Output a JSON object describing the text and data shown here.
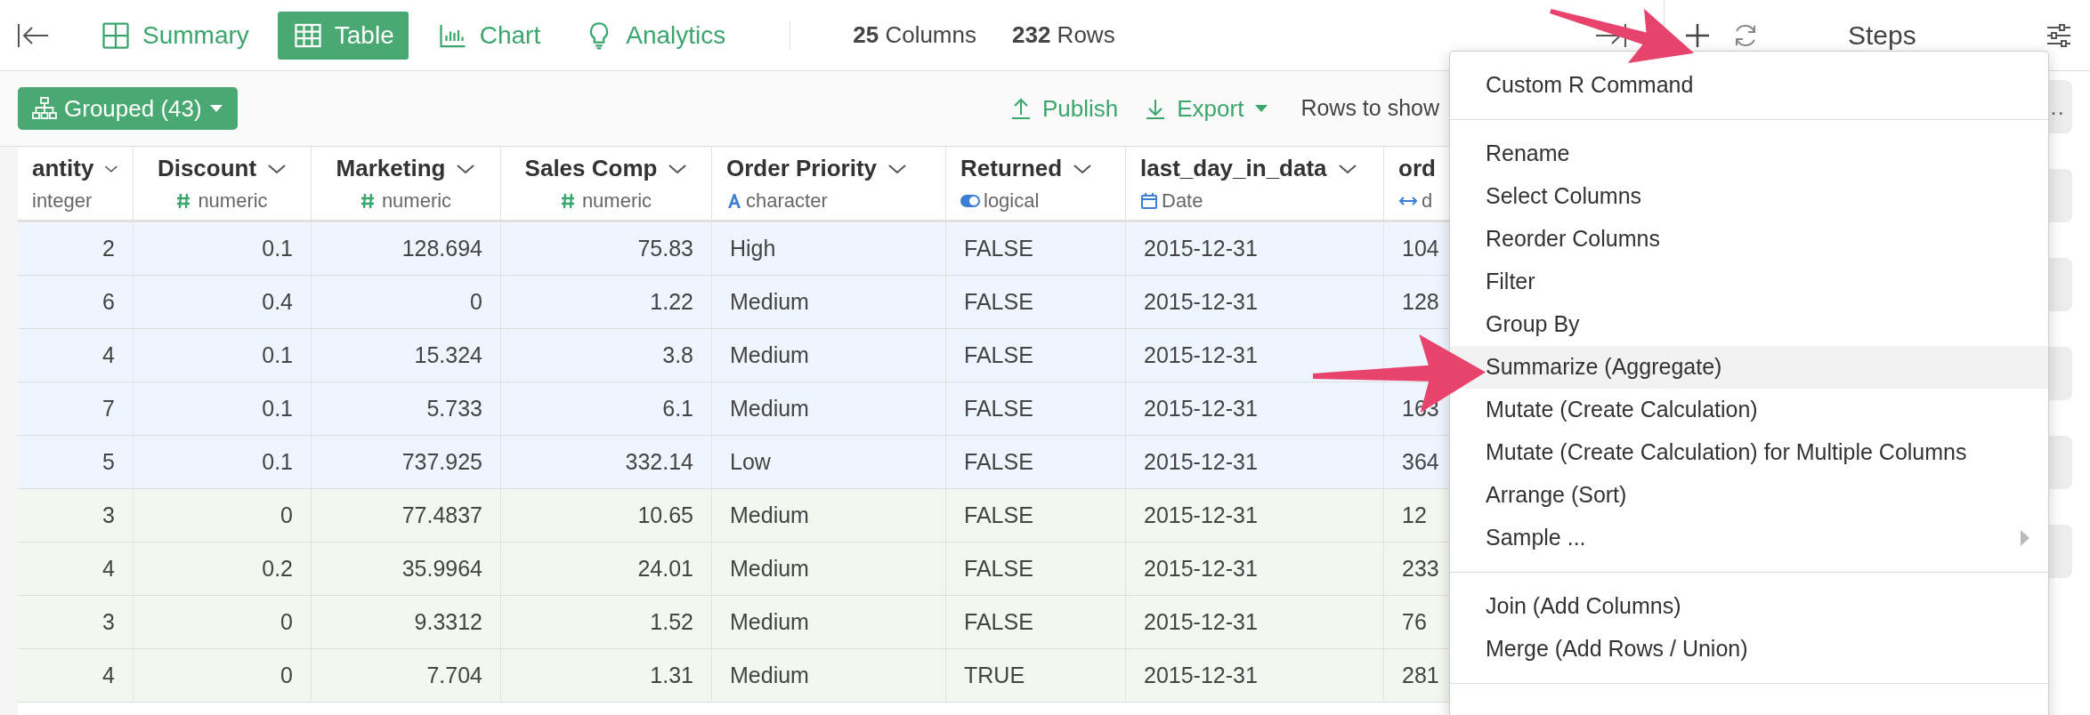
{
  "top_bar": {
    "tabs": [
      {
        "label": "Summary",
        "kind": "summary",
        "selected": false
      },
      {
        "label": "Table",
        "kind": "table",
        "selected": true
      },
      {
        "label": "Chart",
        "kind": "chart",
        "selected": false
      },
      {
        "label": "Analytics",
        "kind": "analytics",
        "selected": false
      }
    ],
    "stats": [
      "**25** Columns",
      "**232** Rows"
    ]
  },
  "toolbar": {
    "group_button": "Grouped (43)",
    "publish": "Publish",
    "export": "Export",
    "rows_to_show": "Rows to show"
  },
  "table": {
    "columns": [
      {
        "name": "antity",
        "type": "integer",
        "kind": "integer",
        "menu": true
      },
      {
        "name": "Discount",
        "type": "numeric",
        "kind": "numeric",
        "menu": true
      },
      {
        "name": "Marketing",
        "type": "numeric",
        "kind": "numeric",
        "menu": true
      },
      {
        "name": "Sales Comp",
        "type": "numeric",
        "kind": "numeric",
        "menu": true
      },
      {
        "name": "Order Priority",
        "type": "character",
        "kind": "character",
        "menu": true
      },
      {
        "name": "Returned",
        "type": "logical",
        "kind": "logical",
        "menu": true
      },
      {
        "name": "last_day_in_data",
        "type": "Date",
        "kind": "date",
        "menu": true
      },
      {
        "name": "ord",
        "type": "d",
        "kind": "difftime",
        "menu": false
      }
    ],
    "rows": [
      {
        "color": "#eef5fe",
        "cells": [
          "2",
          "0.1",
          "128.694",
          "75.83",
          "High",
          "FALSE",
          "2015-12-31",
          "104"
        ]
      },
      {
        "color": "#eef5fe",
        "cells": [
          "6",
          "0.4",
          "0",
          "1.22",
          "Medium",
          "FALSE",
          "2015-12-31",
          "128"
        ]
      },
      {
        "color": "#eef5fe",
        "cells": [
          "4",
          "0.1",
          "15.324",
          "3.8",
          "Medium",
          "FALSE",
          "2015-12-31",
          null
        ]
      },
      {
        "color": "#eef5fe",
        "cells": [
          "7",
          "0.1",
          "5.733",
          "6.1",
          "Medium",
          "FALSE",
          "2015-12-31",
          "163"
        ]
      },
      {
        "color": "#eef5fe",
        "cells": [
          "5",
          "0.1",
          "737.925",
          "332.14",
          "Low",
          "FALSE",
          "2015-12-31",
          "364"
        ]
      },
      {
        "color": "#f2f7ef",
        "cells": [
          "3",
          "0",
          "77.4837",
          "10.65",
          "Medium",
          "FALSE",
          "2015-12-31",
          "12"
        ]
      },
      {
        "color": "#f2f7ef",
        "cells": [
          "4",
          "0.2",
          "35.9964",
          "24.01",
          "Medium",
          "FALSE",
          "2015-12-31",
          "233"
        ]
      },
      {
        "color": "#f2f7ef",
        "cells": [
          "3",
          "0",
          "9.3312",
          "1.52",
          "Medium",
          "FALSE",
          "2015-12-31",
          "76"
        ]
      },
      {
        "color": "#f2f7ef",
        "cells": [
          "4",
          "0",
          "7.704",
          "1.31",
          "Medium",
          "TRUE",
          "2015-12-31",
          "281"
        ]
      }
    ]
  },
  "steps": {
    "title": "Steps",
    "more": "…"
  },
  "menu": {
    "sections": [
      {
        "items": [
          {
            "label": "Custom R Command",
            "highlighted": false,
            "submenu": false
          }
        ]
      },
      {
        "items": [
          {
            "label": "Rename",
            "highlighted": false,
            "submenu": false
          },
          {
            "label": "Select Columns",
            "highlighted": false,
            "submenu": false
          },
          {
            "label": "Reorder Columns",
            "highlighted": false,
            "submenu": false
          },
          {
            "label": "Filter",
            "highlighted": false,
            "submenu": false
          },
          {
            "label": "Group By",
            "highlighted": false,
            "submenu": false
          },
          {
            "label": "Summarize (Aggregate)",
            "highlighted": true,
            "submenu": false
          },
          {
            "label": "Mutate (Create Calculation)",
            "highlighted": false,
            "submenu": false
          },
          {
            "label": "Mutate (Create Calculation) for Multiple Columns",
            "highlighted": false,
            "submenu": false
          },
          {
            "label": "Arrange (Sort)",
            "highlighted": false,
            "submenu": false
          },
          {
            "label": "Sample ...",
            "highlighted": false,
            "submenu": true
          }
        ]
      },
      {
        "items": [
          {
            "label": "Join (Add Columns)",
            "highlighted": false,
            "submenu": false
          },
          {
            "label": "Merge (Add Rows / Union)",
            "highlighted": false,
            "submenu": false
          }
        ]
      }
    ]
  }
}
